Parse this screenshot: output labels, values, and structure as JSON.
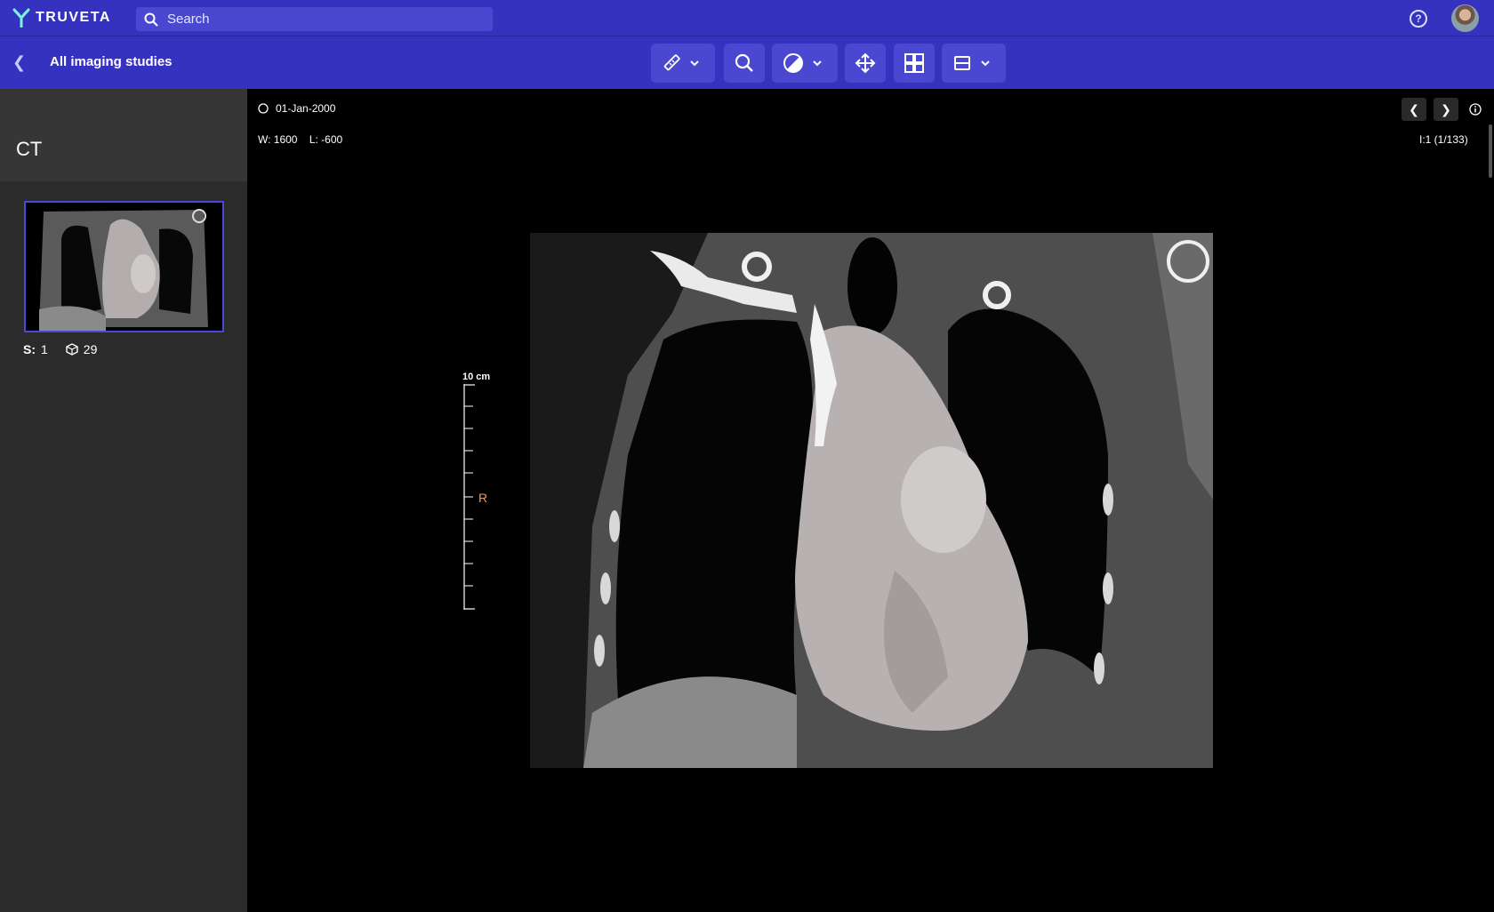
{
  "header": {
    "brand": "TRUVETA",
    "search_placeholder": "Search",
    "help_icon": "question-circle-icon",
    "avatar": "user-avatar"
  },
  "toolbar": {
    "back_label": "All imaging studies",
    "tools": [
      "ruler-icon",
      "zoom-icon",
      "contrast-icon",
      "move-icon",
      "layout-grid-icon",
      "layout-rows-icon"
    ]
  },
  "sidebar": {
    "modality": "CT",
    "series": [
      {
        "s_label": "S:",
        "s_value": "1",
        "count": "29"
      }
    ]
  },
  "viewer": {
    "date": "01-Jan-2000",
    "window": "W: 1600",
    "level": "L: -600",
    "image_index": "I:1 (1/133)",
    "scale_label": "10 cm",
    "orientation": "R",
    "orientation_color": "#e69a6a"
  }
}
